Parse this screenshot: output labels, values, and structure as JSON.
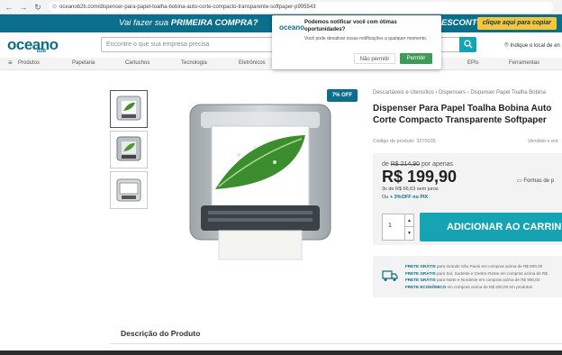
{
  "browser": {
    "url": "oceanob2b.com/dispenser-para-papel-toalha-bobina-auto-corte-compacto-transparente-softpaper-p995543"
  },
  "promo": {
    "text_prefix": "Vai fazer sua",
    "text_bold": "PRIMEIRA COMPRA?",
    "text_right": "ESCONTO",
    "button": "clique aqui para copiar"
  },
  "header": {
    "logo": "oceano",
    "logo_sub": "B2B",
    "search_placeholder": "Encontre o que sua empresa precisa",
    "location": "Indique o local de en"
  },
  "catnav": {
    "items": [
      "Produtos",
      "Papelaria",
      "Cartuchos",
      "Tecnologia",
      "Eletrônicos",
      "EPIs",
      "Ferramentas"
    ]
  },
  "notification": {
    "logo": "oceano",
    "title": "Podemos notificar você com ótimas oportunidades?",
    "text": "Você pode desativar essas notificações a qualquer momento.",
    "deny": "Não permitir",
    "allow": "Permitir"
  },
  "product": {
    "badge": "7% OFF",
    "breadcrumb": "Descartáveis e Utensílios › Dispensers › Dispenser Papel Toalha Bobina",
    "title": "Dispenser Para Papel Toalha Bobina Auto Corte Compacto Transparente Softpaper",
    "code": "Código do produto: 3270035",
    "sold_by": "Vendido e ent",
    "old_price_prefix": "de",
    "old_price": "R$ 214,90",
    "old_price_suffix": "por apenas",
    "price": "R$ 199,90",
    "installments": "3x de R$ 66,63 sem juros",
    "pix_prefix": "Ou",
    "pix_discount": "+ 3%OFF no PIX",
    "payment_methods": "Formas de p",
    "quantity": "1",
    "add_to_cart": "ADICIONAR AO CARRINHO"
  },
  "shipping": {
    "lines": [
      {
        "bold": "FRETE GRÁTIS",
        "text": "para Grande São Paulo em compras acima de R$ 500,00"
      },
      {
        "bold": "FRETE GRÁTIS",
        "text": "para Sul, Sudeste e Centro-Oeste em compras acima de R$"
      },
      {
        "bold": "FRETE GRÁTIS",
        "text": "para Norte e Nordeste em compras acima de R$ 900,00"
      },
      {
        "bold": "FRETE ECONÔMICO",
        "text": "em compras acima de R$ 200,00 em produtos"
      }
    ]
  },
  "description": {
    "heading": "Descrição do Produto"
  },
  "colors": {
    "brand": "#0b6e8a",
    "accent": "#16a3b3",
    "promo_button": "#f5c53a",
    "allow_button": "#3d9b58"
  }
}
